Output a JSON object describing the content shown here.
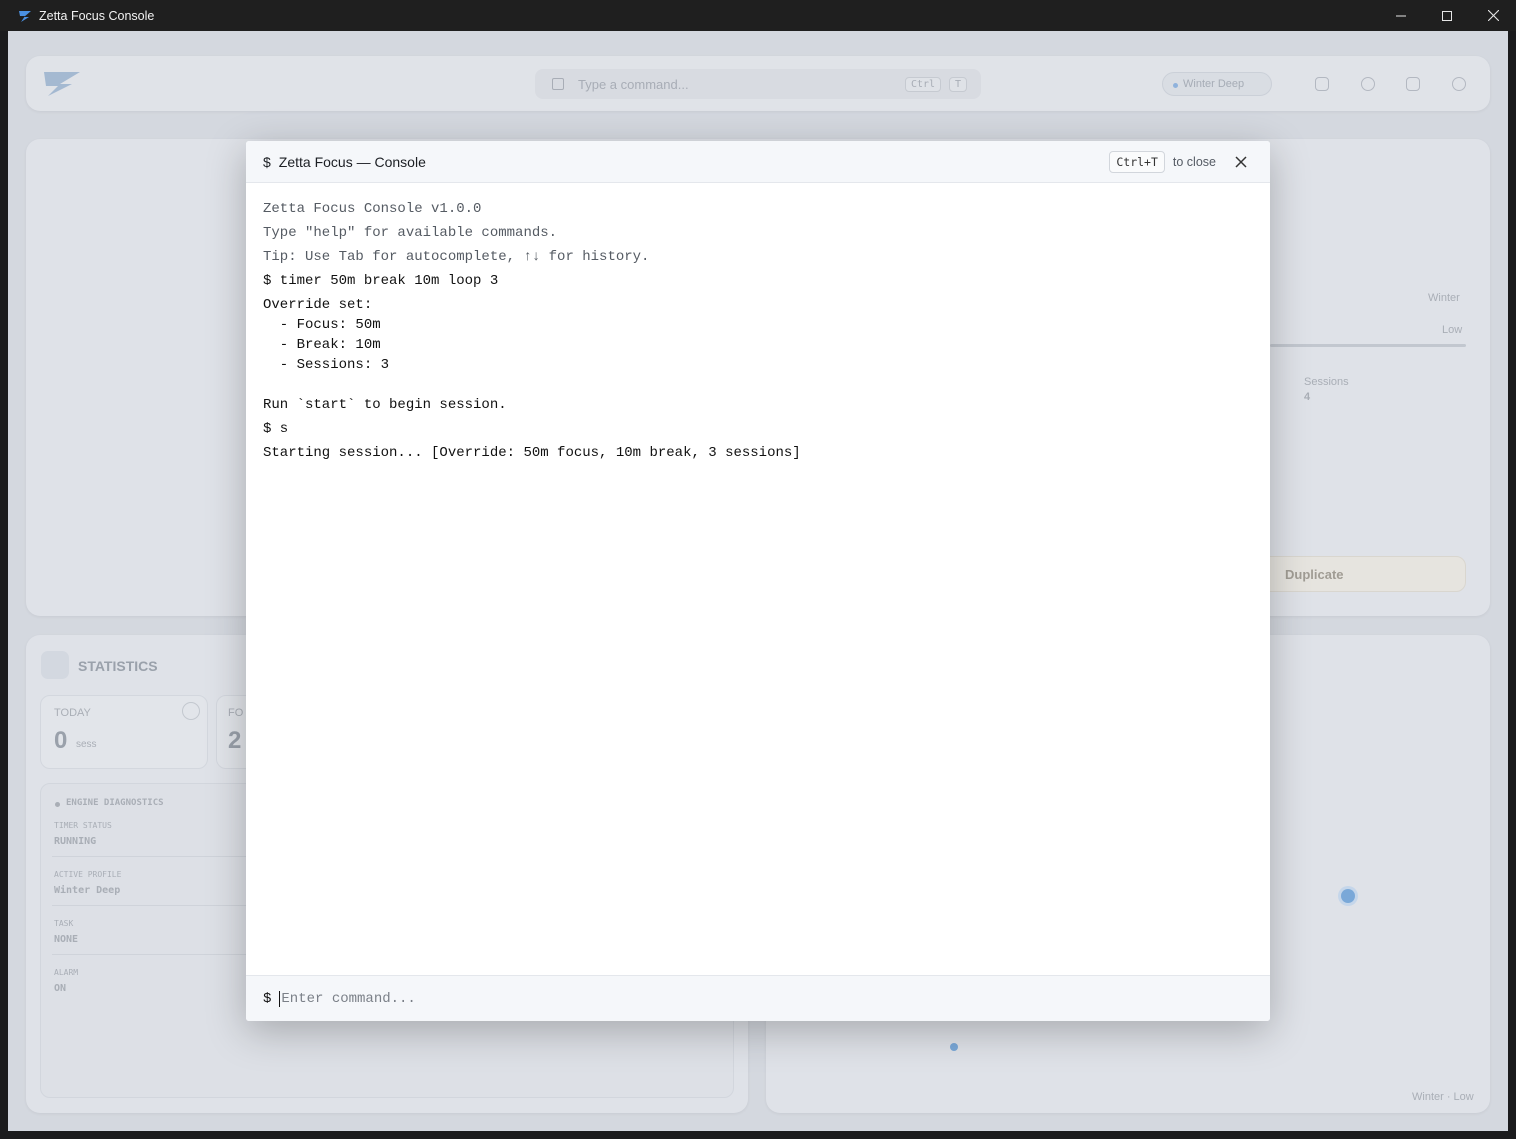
{
  "window": {
    "title": "Zetta Focus Console"
  },
  "background": {
    "command_placeholder": "Type a command...",
    "command_kbd_1": "Ctrl",
    "command_kbd_2": "T",
    "profile_pill": "Winter Deep",
    "main": {
      "season_label": "Winter",
      "level_label": "Low",
      "sessions_label": "Sessions",
      "sessions_value": "4",
      "duplicate_button": "Duplicate"
    },
    "statistics": {
      "title": "STATISTICS",
      "today_label": "TODAY",
      "today_value": "0",
      "today_unit": "sess",
      "second_label": "FO",
      "second_value": "2"
    },
    "diagnostics": {
      "title": "ENGINE DIAGNOSTICS",
      "rows": [
        {
          "label": "TIMER STATUS",
          "value": "RUNNING"
        },
        {
          "label": "ACTIVE PROFILE",
          "value": "Winter Deep"
        },
        {
          "label": "TASK",
          "value": "NONE"
        },
        {
          "label": "ALARM",
          "value": "ON"
        }
      ]
    },
    "chart_footer": "Winter · Low"
  },
  "console": {
    "title_prefix": "$",
    "title": "Zetta Focus — Console",
    "close_kbd": "Ctrl+T",
    "close_hint": "to close",
    "output": {
      "banner": "Zetta Focus Console v1.0.0",
      "help_hint": "Type \"help\" for available commands.",
      "tip": "Tip: Use Tab for autocomplete, ↑↓ for history.",
      "cmd1": "$ timer 50m break 10m loop 3",
      "override_block": "Override set:\n  - Focus: 50m\n  - Break: 10m\n  - Sessions: 3\n\nRun `start` to begin session.",
      "cmd2": "$ s",
      "result": "Starting session... [Override: 50m focus, 10m break, 3 sessions]"
    },
    "input": {
      "prompt": "$",
      "placeholder": "Enter command...",
      "value": ""
    }
  }
}
